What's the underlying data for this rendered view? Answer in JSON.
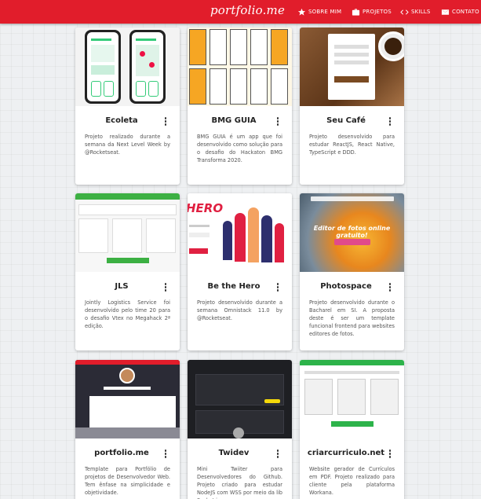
{
  "nav": {
    "brand": "portfolio.me",
    "items": [
      {
        "label": "SOBRE MIM",
        "icon": "star-icon"
      },
      {
        "label": "PROJETOS",
        "icon": "briefcase-icon"
      },
      {
        "label": "SKILLS",
        "icon": "code-icon"
      },
      {
        "label": "CONTATO",
        "icon": "mail-icon"
      }
    ],
    "colors": {
      "bar": "#e11d2b",
      "text": "#ffffff"
    }
  },
  "projects": [
    {
      "title": "Ecoleta",
      "description": "Projeto realizado durante a semana da Next Level Week by @Rocketseat."
    },
    {
      "title": "BMG GUIA",
      "description": "BMG GUIA é um app que foi desenvolvido como solução para o desafio do Hackaton BMG Transforma 2020."
    },
    {
      "title": "Seu Café",
      "description": "Projeto desenvolvido para estudar ReactJS, React Native, TypeScript e DDD."
    },
    {
      "title": "JLS",
      "description": "Jointly Logistics Service foi desenvolvido pelo time 20 para o desafio Vtex no Megahack 2ª edição."
    },
    {
      "title": "Be the Hero",
      "description": "Projeto desenvolvido durante a semana Omnistack 11.0 by @Rocketseat."
    },
    {
      "title": "Photospace",
      "description": "Projeto desenvolvido durante o Bacharel em SI. A proposta deste é ser um template funcional frontend para websites editores de fotos."
    },
    {
      "title": "portfolio.me",
      "description": "Template para Portfólio de projetos de Desenvolvedor Web. Tem ênfase na simplicidade e objetividade."
    },
    {
      "title": "Twidev",
      "description": "Mini Twiiter para Desenvolvedores do Github. Projeto criado para estudar NodeJS com WSS por meio da lib Socket.io."
    },
    {
      "title": "criarcurriculo.net",
      "description": "Website gerador de Currículos em PDF. Projeto realizado para cliente pela plataforma Workana."
    }
  ],
  "thumbs": {
    "bethehero_logo": "HERO",
    "photospace_headline": "Editor de fotos online gratuito!"
  }
}
